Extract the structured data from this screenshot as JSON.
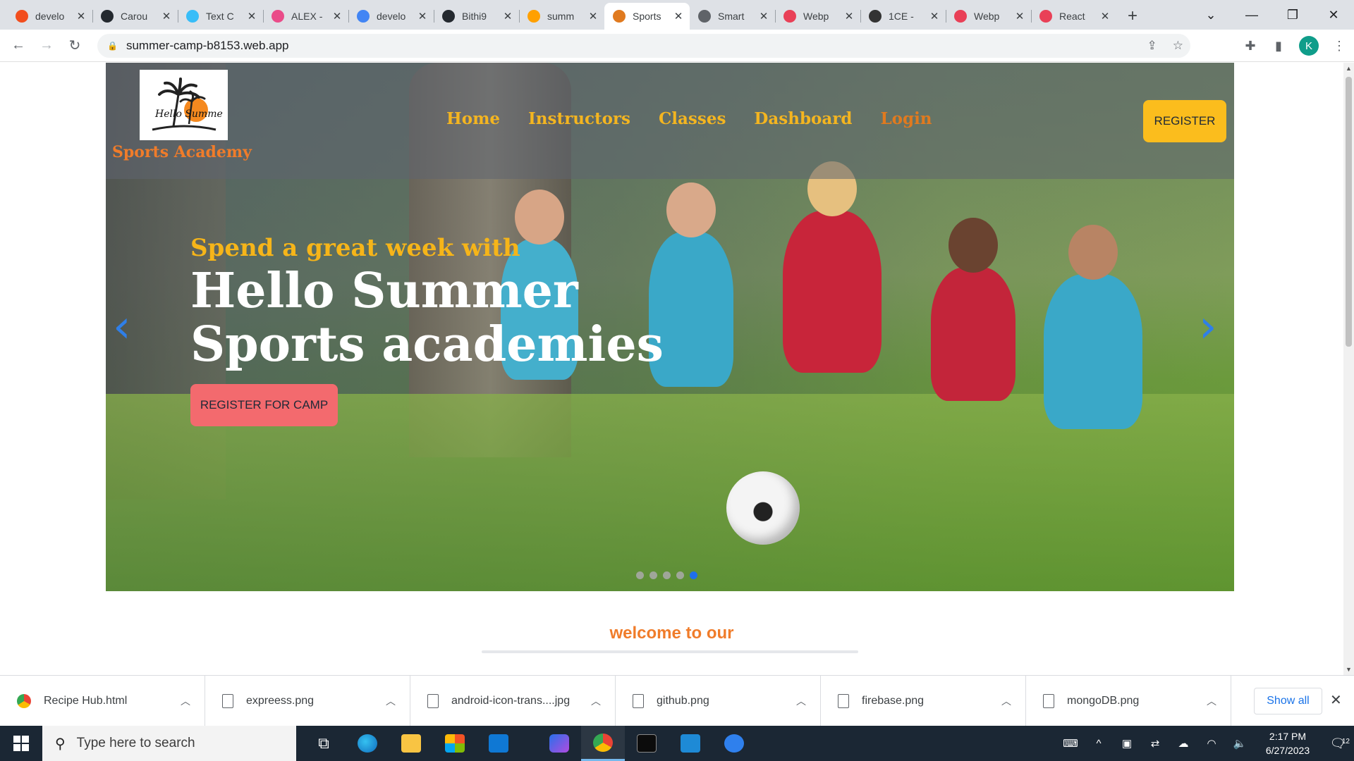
{
  "browser": {
    "tabs": [
      {
        "title": "develo",
        "favicon": "figma-icon",
        "color": "#f24e1e"
      },
      {
        "title": "Carou",
        "favicon": "github-mark-icon",
        "color": "#24292f"
      },
      {
        "title": "Text C",
        "favicon": "tailwind-icon",
        "color": "#38bdf8"
      },
      {
        "title": "ALEX -",
        "favicon": "dribbble-icon",
        "color": "#ea4c89"
      },
      {
        "title": "develo",
        "favicon": "google-icon",
        "color": "#4285f4"
      },
      {
        "title": "Bithi9",
        "favicon": "github-icon",
        "color": "#24292f"
      },
      {
        "title": "summ",
        "favicon": "firebase-icon",
        "color": "#ffa000"
      },
      {
        "title": "Sports",
        "favicon": "site-icon",
        "color": "#e07a1f",
        "active": true
      },
      {
        "title": "Smart",
        "favicon": "globe-icon",
        "color": "#5f6368"
      },
      {
        "title": "Webp",
        "favicon": "rainbow-icon",
        "color": "#e94057"
      },
      {
        "title": "1CE -",
        "favicon": "camera-icon",
        "color": "#333333"
      },
      {
        "title": "Webp",
        "favicon": "rainbow-icon",
        "color": "#e94057"
      },
      {
        "title": "React",
        "favicon": "react-icon",
        "color": "#e94057"
      }
    ],
    "url": "summer-camp-b8153.web.app",
    "profile_initial": "K"
  },
  "site": {
    "brand": "Sports Academy",
    "logo_script": "Hello Summer",
    "nav": [
      "Home",
      "Instructors",
      "Classes",
      "Dashboard",
      "Login"
    ],
    "register_label": "REGISTER",
    "hero": {
      "tagline": "Spend a great week with",
      "headline_line1": "Hello Summer",
      "headline_line2": "Sports academies",
      "cta_label": "REGISTER FOR CAMP",
      "slide_count": 5,
      "active_slide": 5
    },
    "welcome_text": "welcome to our"
  },
  "downloads": {
    "items": [
      {
        "name": "Recipe Hub.html",
        "icon": "chrome-icon"
      },
      {
        "name": "expreess.png",
        "icon": "file-icon"
      },
      {
        "name": "android-icon-trans....jpg",
        "icon": "file-icon"
      },
      {
        "name": "github.png",
        "icon": "file-icon"
      },
      {
        "name": "firebase.png",
        "icon": "file-icon"
      },
      {
        "name": "mongoDB.png",
        "icon": "file-icon"
      }
    ],
    "show_all_label": "Show all"
  },
  "taskbar": {
    "search_placeholder": "Type here to search",
    "time": "2:17 PM",
    "date": "6/27/2023",
    "notification_count": "12"
  }
}
